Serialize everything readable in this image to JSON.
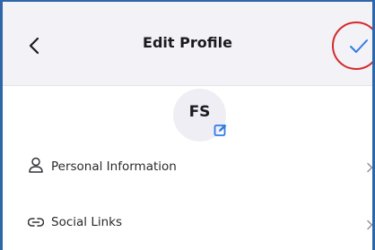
{
  "header": {
    "title": "Edit Profile",
    "back_icon": "chevron-left-icon",
    "save_icon": "checkmark-icon"
  },
  "avatar": {
    "initials": "FS",
    "edit_icon": "edit-pencil-icon"
  },
  "menu": {
    "items": [
      {
        "label": "Personal Information",
        "icon": "person-icon"
      },
      {
        "label": "Social Links",
        "icon": "link-icon"
      }
    ]
  },
  "colors": {
    "header_bg": "#f3f2f7",
    "accent": "#2f7be5",
    "highlight_ring": "#d32b2b",
    "frame_border": "#2f66a8"
  }
}
